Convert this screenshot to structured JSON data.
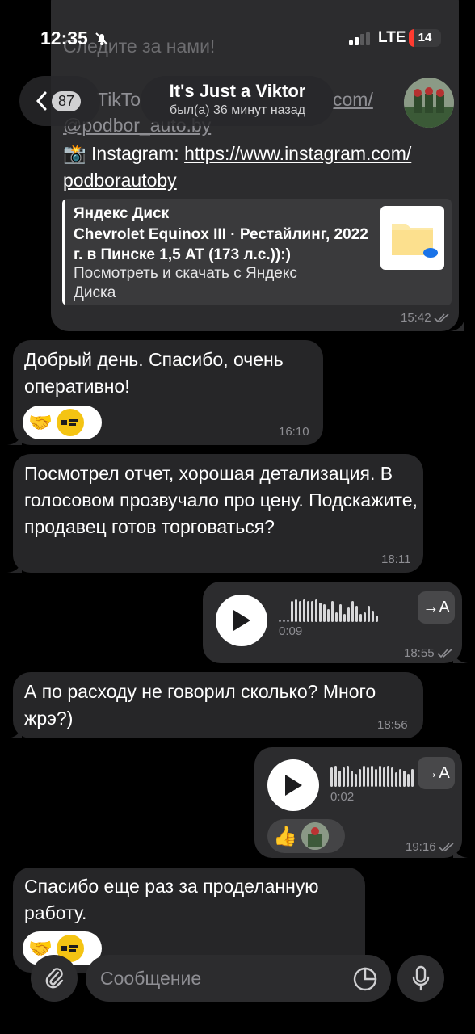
{
  "status_bar": {
    "time": "12:35",
    "network": "LTE",
    "battery": "14",
    "battery_level": 0.14
  },
  "header": {
    "back_count": "87",
    "contact_name": "It's Just a Viktor",
    "last_seen": "был(а) 36 минут назад"
  },
  "messages": {
    "m1": {
      "partial_top": "Следите за нами!",
      "tiktok_prefix": "TikTo",
      "tiktok_suffix": "com/",
      "tiktok_handle": "@podbor_auto.by",
      "instagram_label": "📸 Instagram: ",
      "instagram_link1": "https://www.instagram.com/",
      "instagram_link2": "podborautoby",
      "preview_site": "Яндекс Диск",
      "preview_title": "Chevrolet Equinox III · Рестайлинг, 2022 г. в Пинске 1,5 AT (173 л.с.)):)",
      "preview_desc": "Посмотреть и скачать с Яндекс Диска",
      "time": "15:42"
    },
    "m2": {
      "text": "Добрый день. Спасибо, очень оперативно!",
      "time": "16:10",
      "reaction1": "🤝"
    },
    "m3": {
      "text": "Посмотрел отчет, хорошая детализация. В голосовом прозвучало про цену. Подскажите, продавец готов торговаться?",
      "time": "18:11"
    },
    "m4": {
      "duration": "0:09",
      "time": "18:55",
      "transcribe": "→A"
    },
    "m5": {
      "text": "А по расходу не говорил сколько? Много жрэ?)",
      "time": "18:56"
    },
    "m6": {
      "duration": "0:02",
      "time": "19:16",
      "transcribe": "→A",
      "reaction1": "👍"
    },
    "m7": {
      "text": "Спасибо еще раз за проделанную работу.",
      "reaction1": "🤝"
    }
  },
  "input": {
    "placeholder": "Сообщение"
  },
  "colors": {
    "bubble": "#262628",
    "background": "#000000",
    "brand_yellow": "#f4c413",
    "battery_red": "#ff3b30"
  }
}
